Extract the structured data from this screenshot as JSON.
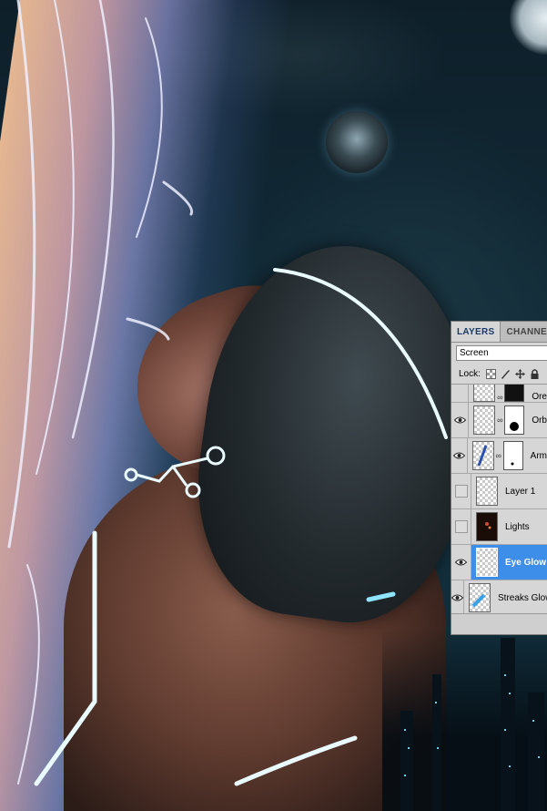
{
  "layers_panel": {
    "tabs": [
      {
        "label": "LAYERS",
        "active": true
      },
      {
        "label": "CHANNELS",
        "active": false
      }
    ],
    "blend_mode": "Screen",
    "lock_label": "Lock:",
    "lock_icons": [
      "lock-transparent-icon",
      "lock-image-icon",
      "lock-position-icon",
      "lock-all-icon"
    ],
    "layers": [
      {
        "name": "Ore",
        "visible": true,
        "has_mask": true,
        "partial": true
      },
      {
        "name": "Orb",
        "visible": true,
        "has_mask": true
      },
      {
        "name": "Arm",
        "visible": true,
        "has_mask": true
      },
      {
        "name": "Layer 1",
        "visible": false,
        "has_mask": false
      },
      {
        "name": "Lights",
        "visible": false,
        "has_mask": false
      },
      {
        "name": "Eye Glow",
        "visible": true,
        "has_mask": false,
        "selected": true
      },
      {
        "name": "Streaks Glow",
        "visible": true,
        "has_mask": false
      }
    ]
  },
  "colors": {
    "selection": "#3d8ee8",
    "panel_bg": "#d6d6d6",
    "glow": "#7fd8f0"
  }
}
